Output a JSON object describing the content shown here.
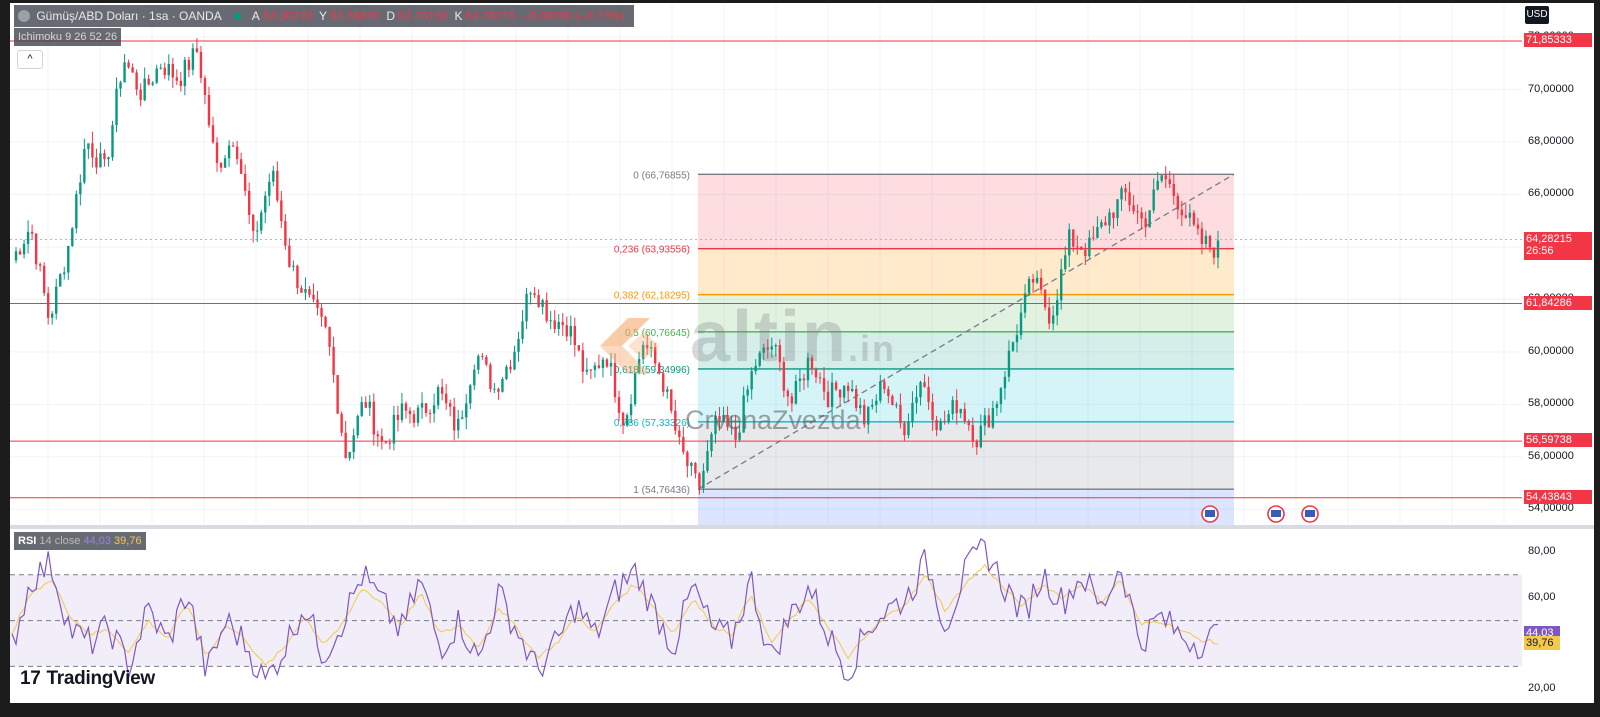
{
  "legend": {
    "symbol": "Gümüş/ABD Doları · 1sa · OANDA",
    "o_label": "A",
    "o_value": "64,30270",
    "h_label": "Y",
    "h_value": "64,38820",
    "l_label": "D",
    "l_value": "64,23150",
    "c_label": "K",
    "c_value": "64,28215",
    "change": "−0,08200 (−0,13%)"
  },
  "indicator_label": "Ichimoku 9 26 52 26",
  "collapse_symbol": "^",
  "currency": "USD",
  "watermark": {
    "brand": "altin",
    "brand_suffix": ".in",
    "author": "CrvenaZvezda"
  },
  "logo_text": "TradingView",
  "logo_glyph": "17",
  "rsi_legend": {
    "name": "RSI",
    "params": "14 close",
    "value1": "44,03",
    "value2": "39,76"
  },
  "colors": {
    "up": "#089981",
    "down": "#f23645",
    "line_level": "#f23645",
    "rsi_line": "#7e57c2",
    "rsi_ma": "#f2c94c"
  },
  "chart_data": [
    {
      "type": "candlestick",
      "symbol": "XAG/USD",
      "timeframe": "1h",
      "ylim": [
        53.4,
        73.3
      ],
      "y_ticks": [
        "54,00000",
        "56,00000",
        "58,00000",
        "60,00000",
        "62,00000",
        "64,00000",
        "66,00000",
        "68,00000",
        "70,00000",
        "72,00000"
      ],
      "last_price": "64,28215",
      "countdown": "26:56",
      "path_y": [
        63.5,
        64.8,
        61.2,
        63.9,
        68.1,
        66.9,
        71.2,
        69.8,
        71.0,
        70.4,
        71.5,
        67.0,
        68.3,
        64.2,
        66.9,
        63.3,
        61.9,
        60.6,
        56.0,
        58.2,
        56.4,
        57.7,
        57.6,
        58.5,
        57.0,
        60.0,
        58.6,
        59.9,
        62.7,
        61.3,
        61.0,
        58.9,
        60.0,
        57.3,
        60.4,
        59.1,
        56.3,
        54.76,
        57.4,
        56.7,
        59.5,
        60.3,
        58.0,
        59.8,
        58.3,
        58.9,
        57.3,
        58.9,
        57.0,
        59.0,
        57.1,
        58.1,
        56.7,
        58.0,
        60.5,
        62.8,
        61.3,
        64.3,
        63.9,
        65.1,
        66.0,
        64.9,
        66.77,
        65.6,
        64.2,
        63.9
      ],
      "levels": [
        {
          "label": "71,85333",
          "value": 71.85333
        },
        {
          "label": "61,84286",
          "value": 61.84286
        },
        {
          "label": "56,59738",
          "value": 56.59738
        },
        {
          "label": "54,43843",
          "value": 54.43843
        }
      ]
    },
    {
      "type": "fibonacci_retracement",
      "high": 66.76855,
      "low": 54.76436,
      "levels": [
        {
          "ratio": "0",
          "value": 66.76855,
          "label": "0 (66,76855)",
          "color": "#787b86",
          "fill": "rgba(242,54,69,0.17)"
        },
        {
          "ratio": "0.236",
          "value": 63.93556,
          "label": "0,236 (63,93556)",
          "color": "#f23645",
          "fill": "rgba(255,152,0,0.2)"
        },
        {
          "ratio": "0.382",
          "value": 62.18295,
          "label": "0,382 (62,18295)",
          "color": "#ff9800",
          "fill": "rgba(76,175,80,0.17)"
        },
        {
          "ratio": "0.5",
          "value": 60.76645,
          "label": "0,5 (60,76645)",
          "color": "#4caf50",
          "fill": "rgba(8,153,129,0.17)"
        },
        {
          "ratio": "0.618",
          "value": 59.34996,
          "label": "0,618 (59,34996)",
          "color": "#089981",
          "fill": "rgba(0,188,212,0.17)"
        },
        {
          "ratio": "0.786",
          "value": 57.33326,
          "label": "0,786 (57,33326)",
          "color": "#00bcd4",
          "fill": "rgba(120,123,134,0.17)"
        },
        {
          "ratio": "1",
          "value": 54.76436,
          "label": "1 (54,76436)",
          "color": "#787b86",
          "fill": "rgba(41,98,255,0.17)"
        }
      ]
    },
    {
      "type": "line",
      "name": "RSI",
      "ylim": [
        14,
        90
      ],
      "y_ticks": [
        "20,00",
        "40,00",
        "60,00",
        "80,00"
      ],
      "bands": [
        30,
        50,
        70
      ],
      "rsi_path": [
        40,
        68,
        75,
        46,
        40,
        47,
        30,
        55,
        40,
        63,
        27,
        50,
        40,
        23,
        38,
        57,
        35,
        50,
        70,
        58,
        45,
        68,
        38,
        50,
        32,
        62,
        45,
        28,
        40,
        57,
        43,
        62,
        72,
        55,
        38,
        65,
        46,
        42,
        68,
        33,
        52,
        65,
        43,
        28,
        47,
        55,
        60,
        76,
        48,
        71,
        82,
        65,
        53,
        70,
        58,
        70,
        55,
        75,
        40,
        52,
        44,
        40,
        44
      ],
      "ma_path": [
        45,
        62,
        68,
        52,
        44,
        46,
        36,
        50,
        42,
        58,
        34,
        48,
        42,
        30,
        38,
        52,
        40,
        48,
        64,
        58,
        48,
        62,
        44,
        48,
        38,
        56,
        46,
        34,
        40,
        52,
        45,
        58,
        66,
        56,
        44,
        60,
        48,
        44,
        62,
        40,
        50,
        60,
        46,
        34,
        44,
        52,
        58,
        70,
        54,
        66,
        74,
        64,
        56,
        66,
        60,
        66,
        58,
        68,
        48,
        50,
        46,
        42,
        40
      ]
    }
  ]
}
